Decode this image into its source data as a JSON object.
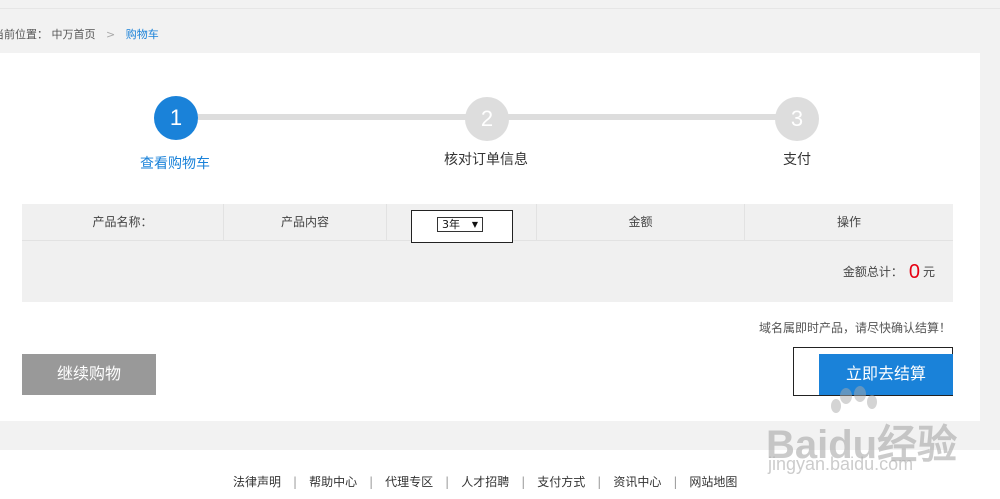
{
  "breadcrumb": {
    "prefix": "当前位置：",
    "home": "中万首页",
    "separator": ">",
    "current": "购物车"
  },
  "steps": [
    {
      "number": "1",
      "label": "查看购物车",
      "active": true
    },
    {
      "number": "2",
      "label": "核对订单信息",
      "active": false
    },
    {
      "number": "3",
      "label": "支付",
      "active": false
    }
  ],
  "table": {
    "headers": {
      "name": "产品名称：",
      "content": "产品内容",
      "amount": "金额",
      "action": "操作"
    },
    "year_select": {
      "value": "3年",
      "arrow": "▼"
    },
    "total_label": "金额总计：",
    "total_amount": "0",
    "total_unit": "元"
  },
  "notice": "域名属即时产品，请尽快确认结算！",
  "buttons": {
    "continue": "继续购物",
    "checkout": "立即去结算"
  },
  "footer": {
    "links": [
      "法律声明",
      "帮助中心",
      "代理专区",
      "人才招聘",
      "支付方式",
      "资讯中心",
      "网站地图"
    ],
    "separator": "|"
  },
  "watermark": {
    "brand": "Baidu经验",
    "url": "jingyan.baidu.com"
  },
  "colors": {
    "accent": "#1a82d9",
    "price": "#e60012",
    "button_gray": "#999999",
    "step_idle": "#dddddd"
  }
}
